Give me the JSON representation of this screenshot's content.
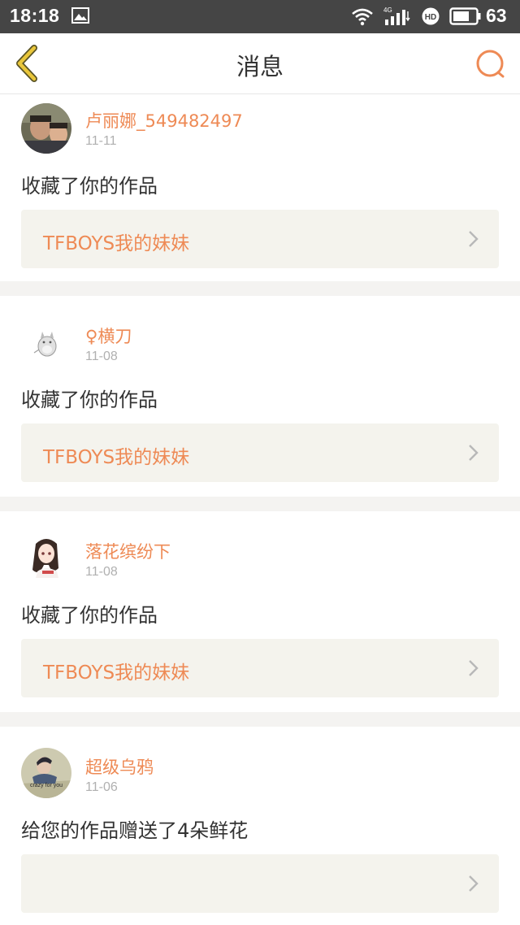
{
  "status_bar": {
    "time": "18:18",
    "battery": "63",
    "network": "4G"
  },
  "header": {
    "title": "消息"
  },
  "colors": {
    "accent": "#ee8a55",
    "back_icon": "#e9c63a",
    "status_bg": "#454545"
  },
  "messages": [
    {
      "user": "卢丽娜_549482497",
      "date": "11-11",
      "action": "收藏了你的作品",
      "work": "TFBOYS我的妹妹"
    },
    {
      "user": "♀横刀",
      "date": "11-08",
      "action": "收藏了你的作品",
      "work": "TFBOYS我的妹妹"
    },
    {
      "user": "落花缤纷下",
      "date": "11-08",
      "action": "收藏了你的作品",
      "work": "TFBOYS我的妹妹"
    },
    {
      "user": "超级乌鸦",
      "date": "11-06",
      "action": "给您的作品赠送了4朵鲜花",
      "work": "",
      "avatar_text": "crazy for you"
    }
  ]
}
